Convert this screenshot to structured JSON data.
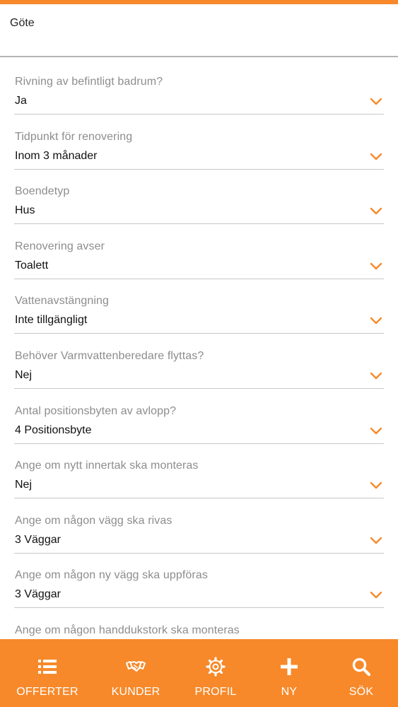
{
  "colors": {
    "accent": "#F7892A",
    "label": "#8d8d8d",
    "value": "#111111",
    "divider": "#c7c7c7"
  },
  "header": {
    "title": "Göte"
  },
  "form": {
    "fields": [
      {
        "label": "Rivning av befintligt badrum?",
        "value": "Ja"
      },
      {
        "label": "Tidpunkt för renovering",
        "value": "Inom 3 månader"
      },
      {
        "label": "Boendetyp",
        "value": "Hus"
      },
      {
        "label": "Renovering avser",
        "value": "Toalett"
      },
      {
        "label": "Vattenavstängning",
        "value": "Inte tillgängligt"
      },
      {
        "label": "Behöver Varmvattenberedare flyttas?",
        "value": "Nej"
      },
      {
        "label": "Antal positionsbyten av avlopp?",
        "value": "4 Positionsbyte"
      },
      {
        "label": "Ange om nytt innertak ska monteras",
        "value": "Nej"
      },
      {
        "label": "Ange om någon vägg ska rivas",
        "value": "3 Väggar"
      },
      {
        "label": "Ange om någon ny vägg ska uppföras",
        "value": "3 Väggar"
      },
      {
        "label": "Ange om någon handdukstork ska monteras",
        "value": ""
      }
    ]
  },
  "nav": {
    "items": [
      {
        "label": "OFFERTER",
        "icon": "list-icon"
      },
      {
        "label": "KUNDER",
        "icon": "handshake-icon"
      },
      {
        "label": "PROFIL",
        "icon": "gear-icon"
      },
      {
        "label": "NY",
        "icon": "plus-icon"
      },
      {
        "label": "SÖK",
        "icon": "search-icon"
      }
    ]
  }
}
